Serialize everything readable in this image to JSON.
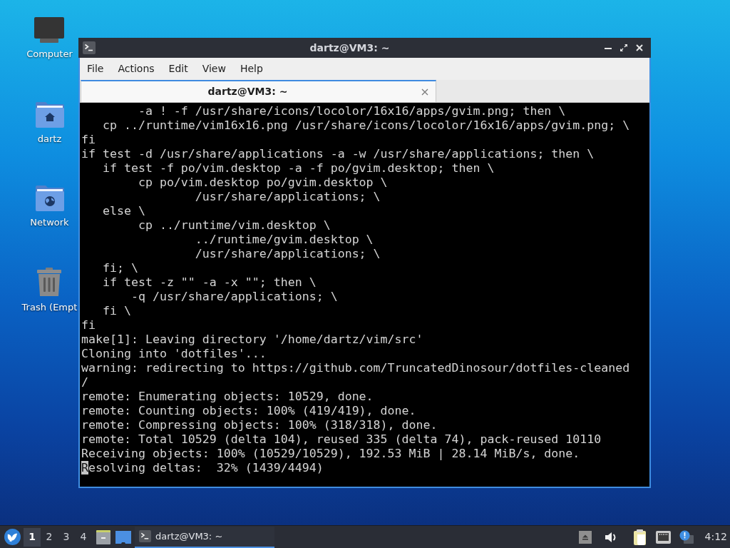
{
  "desktop": {
    "icons": [
      {
        "kind": "computer",
        "label": "Computer"
      },
      {
        "kind": "home",
        "label": "dartz"
      },
      {
        "kind": "network",
        "label": "Network"
      },
      {
        "kind": "trash",
        "label": "Trash (Empt"
      }
    ]
  },
  "window": {
    "title": "dartz@VM3: ~",
    "menu": [
      "File",
      "Actions",
      "Edit",
      "View",
      "Help"
    ],
    "tabs": [
      {
        "label": "dartz@VM3: ~",
        "selected": true
      }
    ],
    "terminal": {
      "lines": [
        {
          "text": "        -a ! -f /usr/share/icons/locolor/16x16/apps/gvim.png; then \\",
          "cursor": false
        },
        {
          "text": "   cp ../runtime/vim16x16.png /usr/share/icons/locolor/16x16/apps/gvim.png; \\",
          "cursor": false
        },
        {
          "text": "fi",
          "cursor": false
        },
        {
          "text": "if test -d /usr/share/applications -a -w /usr/share/applications; then \\",
          "cursor": false
        },
        {
          "text": "   if test -f po/vim.desktop -a -f po/gvim.desktop; then \\",
          "cursor": false
        },
        {
          "text": "        cp po/vim.desktop po/gvim.desktop \\",
          "cursor": false
        },
        {
          "text": "                /usr/share/applications; \\",
          "cursor": false
        },
        {
          "text": "   else \\",
          "cursor": false
        },
        {
          "text": "        cp ../runtime/vim.desktop \\",
          "cursor": false
        },
        {
          "text": "                ../runtime/gvim.desktop \\",
          "cursor": false
        },
        {
          "text": "                /usr/share/applications; \\",
          "cursor": false
        },
        {
          "text": "   fi; \\",
          "cursor": false
        },
        {
          "text": "   if test -z \"\" -a -x \"\"; then \\",
          "cursor": false
        },
        {
          "text": "       -q /usr/share/applications; \\",
          "cursor": false
        },
        {
          "text": "   fi \\",
          "cursor": false
        },
        {
          "text": "fi",
          "cursor": false
        },
        {
          "text": "make[1]: Leaving directory '/home/dartz/vim/src'",
          "cursor": false
        },
        {
          "text": "Cloning into 'dotfiles'...",
          "cursor": false
        },
        {
          "text": "warning: redirecting to https://github.com/TruncatedDinosour/dotfiles-cleaned",
          "cursor": false
        },
        {
          "text": "/",
          "cursor": false
        },
        {
          "text": "remote: Enumerating objects: 10529, done.",
          "cursor": false
        },
        {
          "text": "remote: Counting objects: 100% (419/419), done.",
          "cursor": false
        },
        {
          "text": "remote: Compressing objects: 100% (318/318), done.",
          "cursor": false
        },
        {
          "text": "remote: Total 10529 (delta 104), reused 335 (delta 74), pack-reused 10110",
          "cursor": false
        },
        {
          "text": "Receiving objects: 100% (10529/10529), 192.53 MiB | 28.14 MiB/s, done.",
          "cursor": false
        },
        {
          "text": "Resolving deltas:  32% (1439/4494)",
          "cursor": true
        }
      ]
    }
  },
  "taskbar": {
    "workspaces": [
      {
        "label": "1",
        "selected": true
      },
      {
        "label": "2",
        "selected": false
      },
      {
        "label": "3",
        "selected": false
      },
      {
        "label": "4",
        "selected": false
      }
    ],
    "tasks": [
      {
        "label": "dartz@VM3: ~",
        "active": true
      }
    ],
    "clock": "4:12"
  }
}
